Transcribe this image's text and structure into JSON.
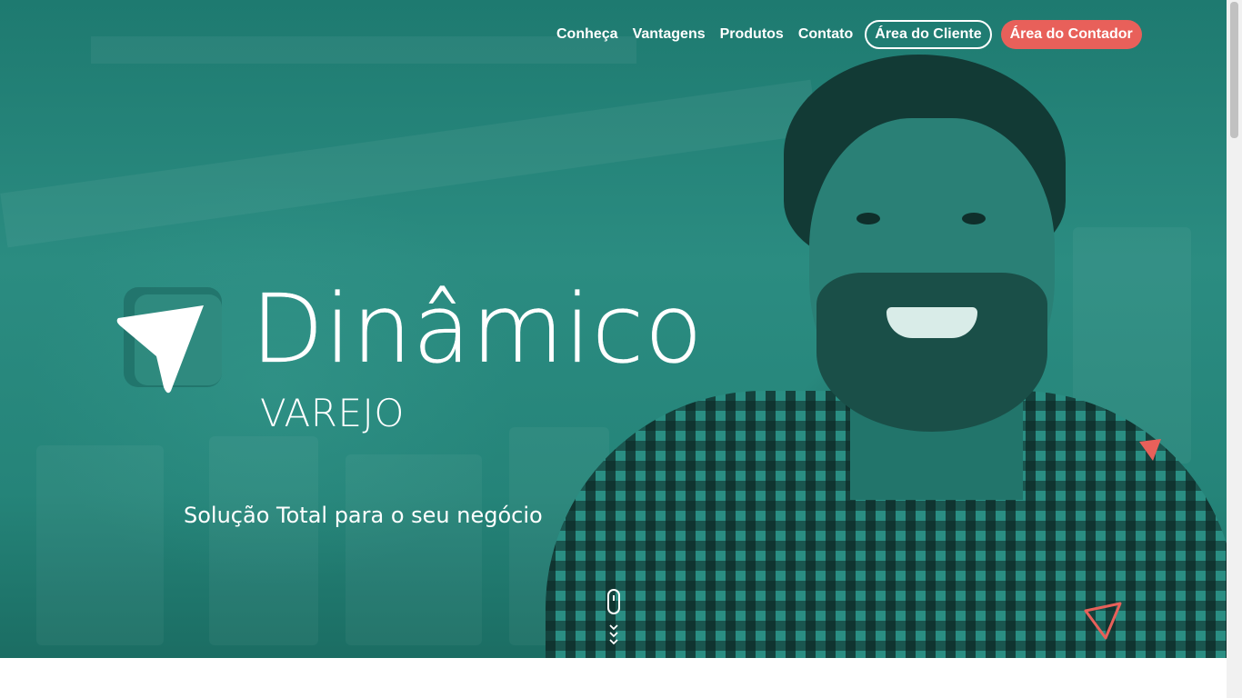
{
  "nav": {
    "links": [
      "Conheça",
      "Vantagens",
      "Produtos",
      "Contato"
    ],
    "client_area": "Área do Cliente",
    "accountant_area": "Área do Contador"
  },
  "hero": {
    "brand_name": "Dinâmico",
    "brand_sub": "VAREJO",
    "tagline": "Solução Total para o seu negócio"
  },
  "colors": {
    "teal": "#2b8c81",
    "accent_coral": "#e8605a",
    "white": "#ffffff"
  },
  "icons": {
    "logo": "paper-plane-logo-icon",
    "scroll": "mouse-scroll-icon",
    "decorations": [
      "coral-triangle-icon",
      "coral-triangle-outline-icon"
    ]
  }
}
